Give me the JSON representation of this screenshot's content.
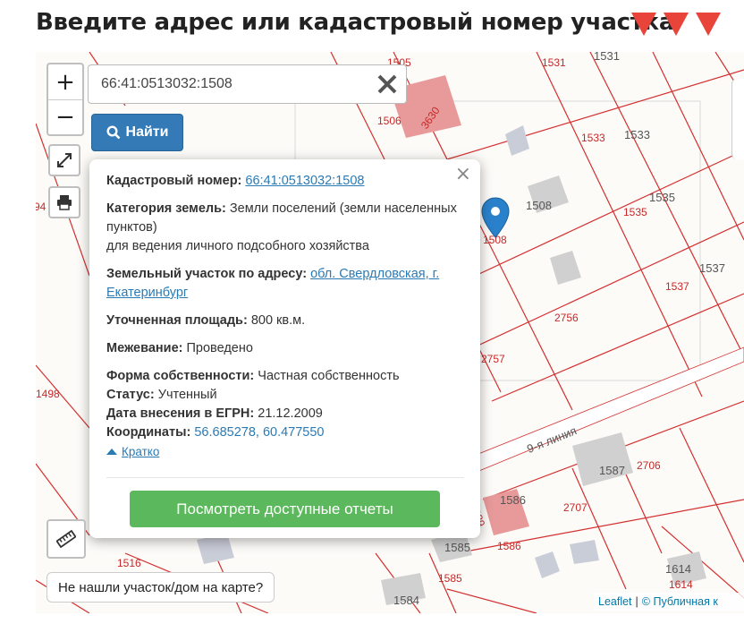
{
  "page_title": "Введите адрес или кадастровый номер участка",
  "colors": {
    "accent_red": "#e8443a",
    "button_blue": "#337ab7",
    "button_green": "#5cb85c",
    "link": "#2a7ab5",
    "parcel_line": "#d32f2f",
    "building": "#e89a9a"
  },
  "map": {
    "parcel_labels": [
      "1505",
      "1531",
      "1531",
      "1506",
      "3630",
      "1533",
      "1533",
      "1508",
      "1508",
      "1535",
      "1535",
      "94",
      "1537",
      "1537",
      "2756",
      "2757",
      "1498",
      "9-я линия",
      "1587",
      "2706",
      "3689",
      "1586",
      "2707",
      "1585",
      "1585",
      "1586",
      "1516",
      "1614",
      "1614",
      "1584"
    ],
    "zoom_in_label": "+",
    "zoom_out_label": "−",
    "fullscreen_icon": "expand-icon",
    "print_icon": "printer-icon",
    "ruler_icon": "ruler-icon",
    "marker_icon": "map-marker-icon"
  },
  "search": {
    "value": "66:41:0513032:1508",
    "button_label": "Найти"
  },
  "popup": {
    "cadastral_label": "Кадастровый номер:",
    "cadastral_value": "66:41:0513032:1508",
    "category_label": "Категория земель:",
    "category_value": "Земли поселений (земли населенных пунктов)",
    "category_use": "для ведения личного подсобного хозяйства",
    "address_label": "Земельный участок по адресу:",
    "address_value": "обл. Свердловская, г. Екатеринбург",
    "area_label": "Уточненная площадь:",
    "area_value": "800 кв.м.",
    "survey_label": "Межевание:",
    "survey_value": "Проведено",
    "ownership_label": "Форма собственности:",
    "ownership_value": "Частная собственность",
    "status_label": "Статус:",
    "status_value": "Учтенный",
    "egrn_date_label": "Дата внесения в ЕГРН:",
    "egrn_date_value": "21.12.2009",
    "coords_label": "Координаты:",
    "coords_value": "56.685278, 60.477550",
    "brief_link": "Кратко",
    "reports_button": "Посмотреть доступные отчеты",
    "close_label": "×"
  },
  "not_found_button": "Не нашли участок/дом на карте?",
  "attribution": {
    "leaflet": "Leaflet",
    "separator": "|",
    "copyright": "© Публичная к"
  }
}
